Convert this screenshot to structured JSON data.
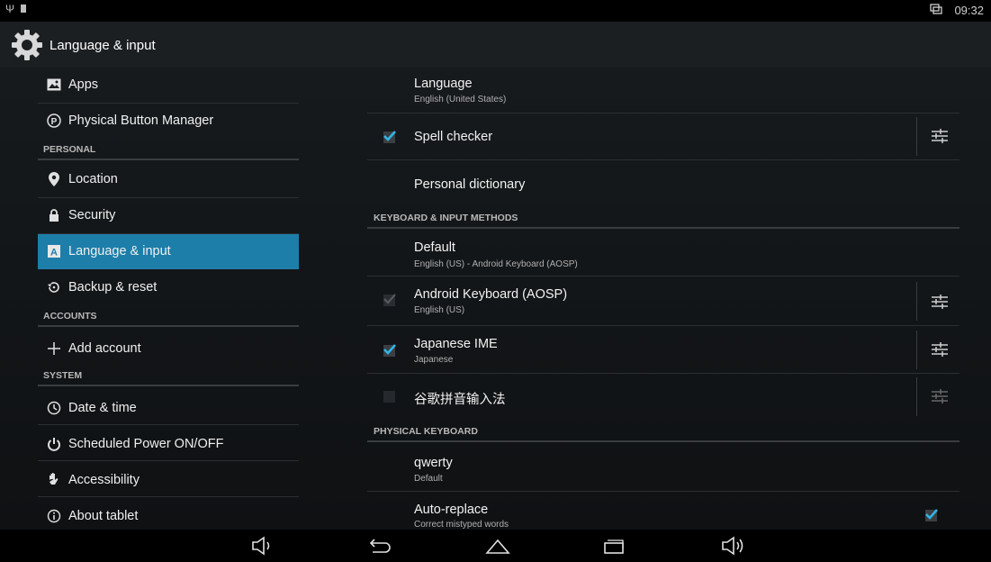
{
  "status_bar": {
    "clock": "09:32",
    "left_icons": [
      "usb-icon",
      "sd-card-icon"
    ],
    "right_icons": [
      "screen-icon"
    ]
  },
  "action_bar": {
    "title": "Language & input",
    "icon": "settings-gear-icon"
  },
  "sidebar": {
    "items": [
      {
        "label": "Apps",
        "icon": "apps-image-icon"
      },
      {
        "label": "Physical Button Manager",
        "icon": "p-circle-icon"
      },
      {
        "header": "PERSONAL"
      },
      {
        "label": "Location",
        "icon": "location-pin-icon"
      },
      {
        "label": "Security",
        "icon": "lock-icon"
      },
      {
        "label": "Language & input",
        "icon": "language-a-icon",
        "selected": true
      },
      {
        "label": "Backup & reset",
        "icon": "backup-restore-icon"
      },
      {
        "header": "ACCOUNTS"
      },
      {
        "label": "Add account",
        "icon": "plus-icon"
      },
      {
        "header": "SYSTEM"
      },
      {
        "label": "Date & time",
        "icon": "clock-icon"
      },
      {
        "label": "Scheduled Power ON/OFF",
        "icon": "power-icon"
      },
      {
        "label": "Accessibility",
        "icon": "hand-icon"
      },
      {
        "label": "About tablet",
        "icon": "info-icon"
      }
    ]
  },
  "main": {
    "language": {
      "title": "Language",
      "summary": "English (United States)"
    },
    "spell_checker": {
      "title": "Spell checker",
      "checked": true
    },
    "personal_dictionary": {
      "title": "Personal dictionary"
    },
    "keyboard_header": "KEYBOARD & INPUT METHODS",
    "default": {
      "title": "Default",
      "summary": "English (US) - Android Keyboard (AOSP)"
    },
    "android_keyboard": {
      "title": "Android Keyboard (AOSP)",
      "summary": "English (US)",
      "checked": true,
      "enabled": false
    },
    "japanese_ime": {
      "title": "Japanese IME",
      "summary": "Japanese",
      "checked": true
    },
    "google_pinyin": {
      "title": "谷歌拼音输入法",
      "checked": false
    },
    "physical_header": "PHYSICAL KEYBOARD",
    "qwerty": {
      "title": "qwerty",
      "summary": "Default"
    },
    "auto_replace": {
      "title": "Auto-replace",
      "summary": "Correct mistyped words",
      "checked": true
    }
  },
  "nav_bar": {
    "buttons": [
      "volume-down-icon",
      "back-icon",
      "home-icon",
      "recents-icon",
      "volume-up-icon"
    ]
  },
  "colors": {
    "accent": "#1d7ea9",
    "check": "#33b5e5",
    "background": "#101214",
    "bar": "#000000"
  }
}
